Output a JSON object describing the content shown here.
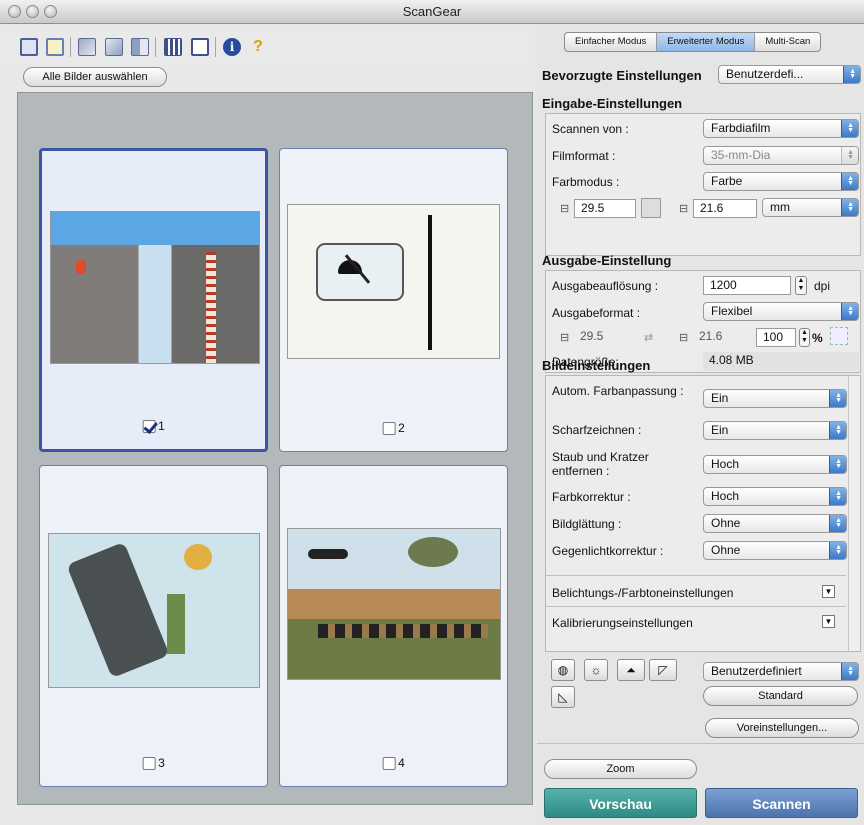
{
  "window": {
    "title": "ScanGear"
  },
  "toolbar": {
    "select_all_label": "Alle Bilder auswählen",
    "icons": [
      "frame-icon",
      "crop-icon",
      "rotate-left-icon",
      "rotate-right-icon",
      "mirror-icon",
      "thumbnail-view-icon",
      "whole-view-icon",
      "info-icon",
      "help-icon"
    ]
  },
  "thumbnails": [
    {
      "num": "1",
      "checked": true
    },
    {
      "num": "2",
      "checked": false
    },
    {
      "num": "3",
      "checked": false
    },
    {
      "num": "4",
      "checked": false
    }
  ],
  "tabs": {
    "simple": "Einfacher Modus",
    "advanced": "Erweiterter Modus",
    "multi": "Multi-Scan"
  },
  "favorites": {
    "label": "Bevorzugte Einstellungen",
    "value": "Benutzerdefi..."
  },
  "input": {
    "title": "Eingabe-Einstellungen",
    "scan_from_label": "Scannen von :",
    "scan_from_value": "Farbdiafilm",
    "film_format_label": "Filmformat :",
    "film_format_value": "35-mm-Dia",
    "color_mode_label": "Farbmodus :",
    "color_mode_value": "Farbe",
    "width": "29.5",
    "height": "21.6",
    "unit": "mm"
  },
  "output": {
    "title": "Ausgabe-Einstellung",
    "resolution_label": "Ausgabeauflösung :",
    "resolution_value": "1200",
    "resolution_unit": "dpi",
    "format_label": "Ausgabeformat :",
    "format_value": "Flexibel",
    "width": "29.5",
    "height": "21.6",
    "scale": "100",
    "scale_unit": "%",
    "data_size_label": "Datengröße:",
    "data_size_value": "4.08 MB"
  },
  "image": {
    "title": "Bildeinstellungen",
    "auto_color_label": "Autom. Farbanpassung :",
    "auto_color_value": "Ein",
    "sharpen_label": "Scharfzeichnen :",
    "sharpen_value": "Ein",
    "dust_label": "Staub und Kratzer entfernen :",
    "dust_value": "Hoch",
    "color_corr_label": "Farbkorrektur :",
    "color_corr_value": "Hoch",
    "smooth_label": "Bildglättung :",
    "smooth_value": "Ohne",
    "backlight_label": "Gegenlichtkorrektur :",
    "backlight_value": "Ohne",
    "exposure_label": "Belichtungs-/Farbtoneinstellungen",
    "calib_label": "Kalibrierungseinstellungen"
  },
  "tools": {
    "preset_value": "Benutzerdefiniert",
    "standard_label": "Standard",
    "prefs_label": "Voreinstellungen..."
  },
  "actions": {
    "zoom_label": "Zoom",
    "preview_label": "Vorschau",
    "scan_label": "Scannen"
  },
  "colors": {
    "preview": "#3d9a94",
    "scan": "#5b82b8",
    "accent": "#3b55a4"
  }
}
